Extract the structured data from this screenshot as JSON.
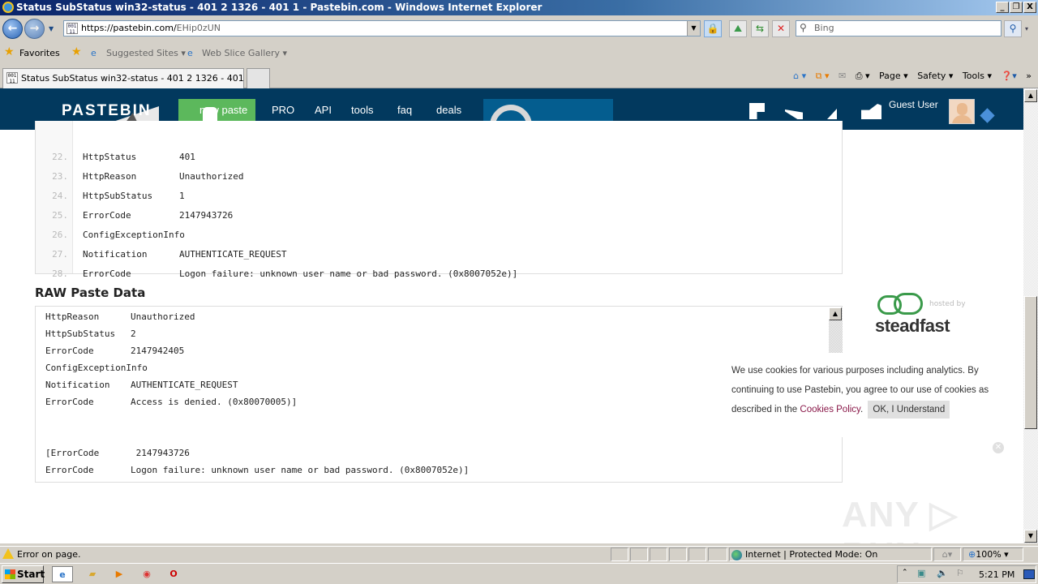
{
  "window": {
    "title": "Status SubStatus win32-status - 401 2 1326 - 401 1 - Pastebin.com - Windows Internet Explorer",
    "controls": {
      "minimize": "_",
      "restore": "❐",
      "close": "X"
    }
  },
  "address_bar": {
    "url_host": "https://pastebin.com/",
    "url_path": "EHip0zUN",
    "search_placeholder": "Bing"
  },
  "favorites_bar": {
    "favorites_label": "Favorites",
    "items": [
      {
        "label": "Suggested Sites ▾"
      },
      {
        "label": "Web Slice Gallery ▾"
      }
    ]
  },
  "tabs": [
    {
      "label": "Status SubStatus win32-status - 401 2 1326 - 401 1 - ...",
      "active": true
    }
  ],
  "command_bar": {
    "page": "Page ▾",
    "safety": "Safety ▾",
    "tools": "Tools ▾",
    "more": "»"
  },
  "site": {
    "logo": "PASTEBIN",
    "nav": [
      {
        "label": "new paste",
        "highlight": true
      },
      {
        "label": "PRO"
      },
      {
        "label": "API"
      },
      {
        "label": "tools"
      },
      {
        "label": "faq"
      },
      {
        "label": "deals"
      }
    ],
    "user": "Guest User",
    "brand_colors": {
      "header": "#02395e",
      "new_paste": "#5cb85c",
      "cookie_link": "#8a1a4a"
    }
  },
  "code_lines": [
    {
      "num": "22.",
      "key": "HttpStatus",
      "value": "401"
    },
    {
      "num": "23.",
      "key": "HttpReason",
      "value": "Unauthorized"
    },
    {
      "num": "24.",
      "key": "HttpSubStatus",
      "value": "1"
    },
    {
      "num": "25.",
      "key": "ErrorCode",
      "value": "2147943726"
    },
    {
      "num": "26.",
      "key": "ConfigExceptionInfo",
      "value": ""
    },
    {
      "num": "27.",
      "key": "Notification",
      "value": "AUTHENTICATE_REQUEST"
    },
    {
      "num": "28.",
      "key": "ErrorCode",
      "value": "Logon failure: unknown user name or bad password. (0x8007052e)]"
    }
  ],
  "raw_paste": {
    "title": "RAW Paste Data",
    "lines": [
      {
        "key": "HttpReason",
        "value": "Unauthorized"
      },
      {
        "key": "HttpSubStatus",
        "value": "2"
      },
      {
        "key": "ErrorCode",
        "value": "2147942405"
      },
      {
        "key": "ConfigExceptionInfo",
        "value": ""
      },
      {
        "key": "Notification",
        "value": "AUTHENTICATE_REQUEST"
      },
      {
        "key": "ErrorCode",
        "value": "Access is denied. (0x80070005)]"
      },
      {
        "key": "",
        "value": ""
      },
      {
        "key": "",
        "value": ""
      },
      {
        "key": "[ErrorCode",
        "value": " 2147943726"
      },
      {
        "key": "ErrorCode",
        "value": "Logon failure: unknown user name or bad password. (0x8007052e)]"
      }
    ]
  },
  "sponsor": {
    "hosted_by": "hosted by",
    "brand": "steadfast"
  },
  "cookie_banner": {
    "text_before": "We use cookies for various purposes including analytics. By continuing to use Pastebin, you agree to our use of cookies as described in the ",
    "link": "Cookies Policy",
    "text_after": ".",
    "button": "OK, I Understand"
  },
  "watermark": "ANY ▷ RUN",
  "status_bar": {
    "message": "Error on page.",
    "zone": "Internet | Protected Mode: On",
    "zoom": "100%"
  },
  "taskbar": {
    "start": "Start",
    "clock": "5:21 PM"
  }
}
